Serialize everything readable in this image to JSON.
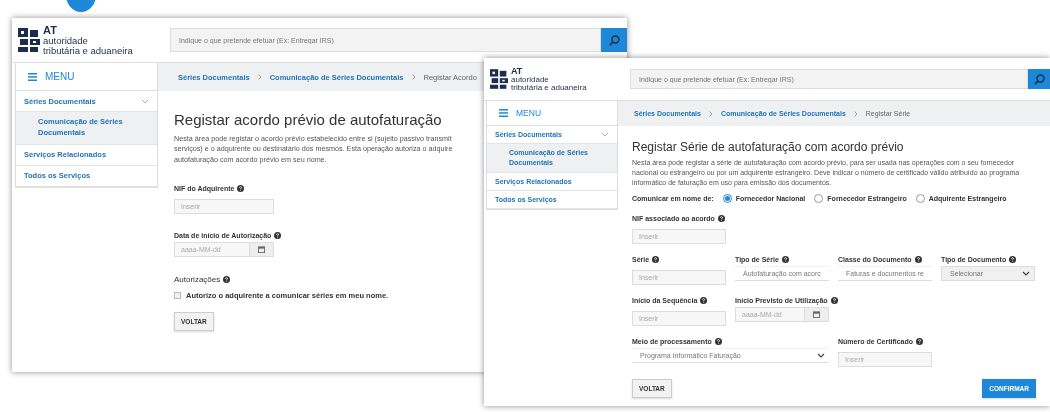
{
  "windows": [
    {
      "logo": {
        "abbr": "AT",
        "line1": "autoridade",
        "line2": "tributária e aduaneira"
      },
      "search": {
        "placeholder": "Indique o que pretende efetuar (Ex: Entregar IRS)"
      },
      "menu_label": "MENU",
      "sidebar": [
        {
          "label": "Séries Documentais",
          "expanded": true,
          "children": [
            {
              "label": "Comunicação de Séries Documentais",
              "selected": true
            }
          ]
        },
        {
          "label": "Serviços Relacionados"
        },
        {
          "label": "Todos os Serviços"
        }
      ],
      "breadcrumb": [
        {
          "label": "Séries Documentais",
          "link": true
        },
        {
          "label": "Comunicação de Séries Documentais",
          "link": true
        },
        {
          "label": "Registar Acordo",
          "link": false
        }
      ],
      "title": "Registar acordo prévio de autofaturação",
      "description": [
        "Nesta área pode registar o acordo prévio estabelecido entre si (sujeito passivo transmit",
        "serviços) e o adquirente ou destinatário dos mesmos. Esta operação autoriza o adquire",
        "autofaturação com acordo prévio em seu nome."
      ],
      "form_rows": [
        [
          {
            "kind": "text",
            "label": "NIF do Adquirente",
            "help": true,
            "placeholder": "Inserir"
          }
        ],
        [
          {
            "kind": "date",
            "label": "Data de início de Autorização",
            "help": true,
            "placeholder": "aaaa-MM-dd"
          }
        ],
        [
          {
            "kind": "checkbox",
            "label": "Autorizações",
            "help": true,
            "option": "Autorizo o adquirente a comunicar séries em meu nome.",
            "checked": false
          }
        ]
      ],
      "buttons": [
        {
          "label": "VOLTAR",
          "kind": "secondary"
        }
      ]
    },
    {
      "logo": {
        "abbr": "AT",
        "line1": "autoridade",
        "line2": "tributária e aduaneira"
      },
      "search": {
        "placeholder": "Indique o que pretende efetuar (Ex: Entregar IRS)"
      },
      "menu_label": "MENU",
      "sidebar": [
        {
          "label": "Séries Documentais",
          "expanded": true,
          "children": [
            {
              "label": "Comunicação de Séries Documentais",
              "selected": true
            }
          ]
        },
        {
          "label": "Serviços Relacionados"
        },
        {
          "label": "Todos os Serviços"
        }
      ],
      "breadcrumb": [
        {
          "label": "Séries Documentais",
          "link": true
        },
        {
          "label": "Comunicação de Séries Documentais",
          "link": true
        },
        {
          "label": "Registar Série",
          "link": false
        }
      ],
      "title": "Registar Série de autofaturação com acordo prévio",
      "description": [
        "Nesta área pode registar a série de autofaturação com acordo prévio, para ser usada nas operações com o seu fornecedor nacional ou estrangeiro ou por um adquirente estrangeiro. Deve indicar o número de certificado válido atribuído ao programa informático de faturação em uso para emissão dos documentos."
      ],
      "form_rows": [
        [
          {
            "kind": "radio",
            "label": "Comunicar em nome de:",
            "options": [
              {
                "label": "Fornecedor Nacional",
                "selected": true
              },
              {
                "label": "Fornecedor Estrangeiro",
                "selected": false
              },
              {
                "label": "Adquirente Estrangeiro",
                "selected": false
              }
            ]
          }
        ],
        [
          {
            "kind": "text",
            "label": "NIF associado ao acordo",
            "help": true,
            "placeholder": "Inserir"
          }
        ],
        [
          {
            "kind": "text",
            "label": "Série",
            "help": true,
            "placeholder": "Inserir"
          },
          {
            "kind": "select",
            "label": "Tipo de Série",
            "help": true,
            "value": "Autofaturação com acorc"
          },
          {
            "kind": "select",
            "label": "Classe do Documento",
            "help": true,
            "value": "Faturas e documentos re"
          },
          {
            "kind": "select",
            "label": "Tipo de Documento",
            "help": true,
            "value": "Selecionar"
          }
        ],
        [
          {
            "kind": "text",
            "label": "Início da Sequência",
            "help": true,
            "placeholder": "Inserir"
          },
          {
            "kind": "date",
            "label": "Início Previsto de Utilização",
            "help": true,
            "placeholder": "aaaa-MM-dd"
          }
        ],
        [
          {
            "kind": "select",
            "label": "Meio de processamento",
            "help": true,
            "value": "Programa Informático Faturação",
            "wide": true
          },
          {
            "kind": "text",
            "label": "Número de Certificado",
            "help": true,
            "placeholder": "Inserir"
          }
        ]
      ],
      "buttons": [
        {
          "label": "VOLTAR",
          "kind": "secondary"
        },
        {
          "label": "CONFIRMAR",
          "kind": "primary"
        }
      ]
    }
  ]
}
